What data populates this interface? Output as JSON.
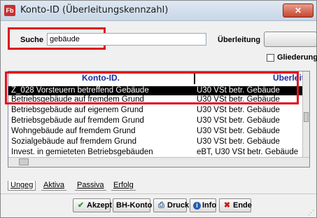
{
  "window": {
    "title": "Konto-ID (Überleitungskennzahl)",
    "icon_text": "Fb",
    "close_glyph": "✕"
  },
  "search": {
    "label": "Suche",
    "value": "gebäude"
  },
  "ueberleitung": {
    "label": "Überleitung"
  },
  "gliederung": {
    "label": "Gliederung",
    "checked": false
  },
  "table": {
    "headers": [
      "Konto-ID.",
      "Überleitung"
    ],
    "rows": [
      {
        "c1": "Z_028 Vorsteuern betreffend Gebäude",
        "c2": "U30 VSt betr. Gebäude",
        "selected": true
      },
      {
        "c1": "Betriebsgebäude auf fremdem Grund",
        "c2": "U30 VSt betr. Gebäude",
        "selected": false
      },
      {
        "c1": "Betriebsgebäude auf eigenem Grund",
        "c2": "U30 VSt betr. Gebäude",
        "selected": false
      },
      {
        "c1": "Betriebsgebäude auf fremdem Grund",
        "c2": "U30 VSt betr. Gebäude",
        "selected": false
      },
      {
        "c1": "Wohngebäude auf fremdem Grund",
        "c2": "U30 VSt betr. Gebäude",
        "selected": false
      },
      {
        "c1": "Sozialgebäude auf fremdem Grund",
        "c2": "U30 VSt betr. Gebäude",
        "selected": false
      },
      {
        "c1": "Invest. in gemieteten Betriebsgebäuden",
        "c2": "eBT, U30 VSt betr. Gebäude",
        "selected": false
      }
    ]
  },
  "tabs": [
    {
      "label": "Ungeg",
      "active": true
    },
    {
      "label": "Aktiva",
      "active": false
    },
    {
      "label": "Passiva",
      "active": false
    },
    {
      "label": "Erfolg",
      "active": false
    }
  ],
  "buttons": {
    "akzept": {
      "label": "Akzept",
      "icon": "check-icon"
    },
    "bhkonto": {
      "label": "BH-Konto",
      "icon": "ledger-icon"
    },
    "druck": {
      "label": "Druck",
      "icon": "printer-icon"
    },
    "info": {
      "label": "Info",
      "icon": "info-icon"
    },
    "ende": {
      "label": "Ende",
      "icon": "cancel-icon"
    }
  },
  "colors": {
    "highlight": "#e0101e",
    "header_text": "#1a2aa0",
    "selected_row_bg": "#000000"
  }
}
